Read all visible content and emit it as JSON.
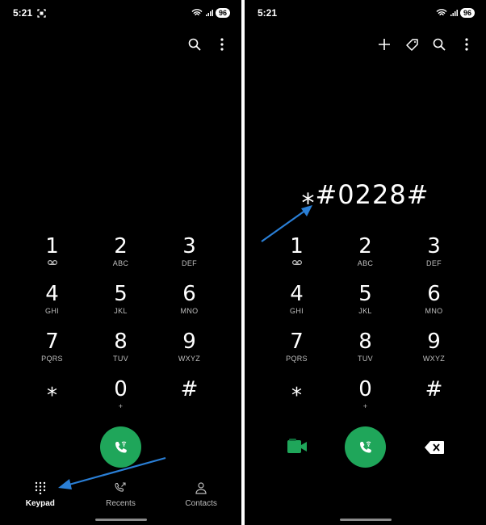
{
  "left": {
    "status": {
      "time": "5:21",
      "battery": "96"
    },
    "keys": [
      {
        "digit": "1",
        "letters": ""
      },
      {
        "digit": "2",
        "letters": "ABC"
      },
      {
        "digit": "3",
        "letters": "DEF"
      },
      {
        "digit": "4",
        "letters": "GHI"
      },
      {
        "digit": "5",
        "letters": "JKL"
      },
      {
        "digit": "6",
        "letters": "MNO"
      },
      {
        "digit": "7",
        "letters": "PQRS"
      },
      {
        "digit": "8",
        "letters": "TUV"
      },
      {
        "digit": "9",
        "letters": "WXYZ"
      },
      {
        "digit": "⁎",
        "letters": ""
      },
      {
        "digit": "0",
        "letters": "+"
      },
      {
        "digit": "#",
        "letters": ""
      }
    ],
    "nav": [
      {
        "label": "Keypad",
        "icon": "keypad-icon",
        "active": true
      },
      {
        "label": "Recents",
        "icon": "recents-icon",
        "active": false
      },
      {
        "label": "Contacts",
        "icon": "contacts-icon",
        "active": false
      }
    ]
  },
  "right": {
    "status": {
      "time": "5:21",
      "battery": "96"
    },
    "dialed": "⁎#0228#",
    "keys": [
      {
        "digit": "1",
        "letters": ""
      },
      {
        "digit": "2",
        "letters": "ABC"
      },
      {
        "digit": "3",
        "letters": "DEF"
      },
      {
        "digit": "4",
        "letters": "GHI"
      },
      {
        "digit": "5",
        "letters": "JKL"
      },
      {
        "digit": "6",
        "letters": "MNO"
      },
      {
        "digit": "7",
        "letters": "PQRS"
      },
      {
        "digit": "8",
        "letters": "TUV"
      },
      {
        "digit": "9",
        "letters": "WXYZ"
      },
      {
        "digit": "⁎",
        "letters": ""
      },
      {
        "digit": "0",
        "letters": "+"
      },
      {
        "digit": "#",
        "letters": ""
      }
    ]
  },
  "colors": {
    "call": "#1fa65a",
    "video": "#1fa65a",
    "arrow": "#2a7fd6",
    "background": "#000000"
  }
}
